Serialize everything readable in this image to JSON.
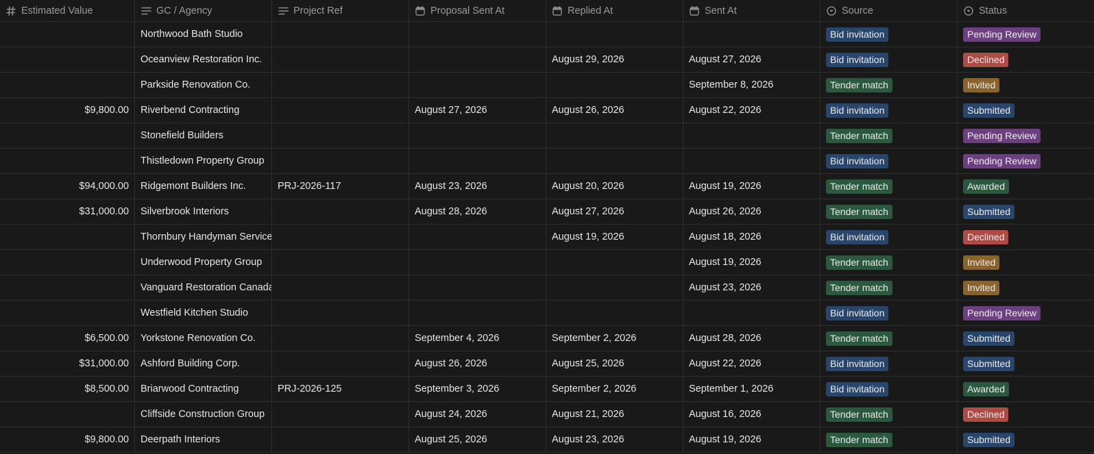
{
  "colors": {
    "background": "#191919",
    "border": "#2f2f2f",
    "text": "#e6e6e4",
    "header_text": "#9b9b9b",
    "tag_bid_invitation": "#28456c",
    "tag_tender_match": "#2b593f",
    "tag_pending_review": "#6c3f81",
    "tag_declined": "#b04a45",
    "tag_invited": "#89632a",
    "tag_submitted": "#28456c",
    "tag_awarded": "#2b593f"
  },
  "columns": [
    {
      "label": "Estimated Value",
      "icon": "number-icon"
    },
    {
      "label": "GC / Agency",
      "icon": "text-lines-icon"
    },
    {
      "label": "Project Ref",
      "icon": "text-lines-icon"
    },
    {
      "label": "Proposal Sent At",
      "icon": "calendar-icon"
    },
    {
      "label": "Replied At",
      "icon": "calendar-icon"
    },
    {
      "label": "Sent At",
      "icon": "calendar-icon"
    },
    {
      "label": "Source",
      "icon": "select-icon"
    },
    {
      "label": "Status",
      "icon": "select-icon"
    }
  ],
  "rows": [
    {
      "value": "",
      "agency": "Northwood Bath Studio",
      "ref": "",
      "proposal": "",
      "replied": "",
      "sent": "",
      "source": "Bid invitation",
      "status": "Pending Review"
    },
    {
      "value": "",
      "agency": "Oceanview Restoration Inc.",
      "ref": "",
      "proposal": "",
      "replied": "August 29, 2026",
      "sent": "August 27, 2026",
      "source": "Bid invitation",
      "status": "Declined"
    },
    {
      "value": "",
      "agency": "Parkside Renovation Co.",
      "ref": "",
      "proposal": "",
      "replied": "",
      "sent": "September 8, 2026",
      "source": "Tender match",
      "status": "Invited"
    },
    {
      "value": "$9,800.00",
      "agency": "Riverbend Contracting",
      "ref": "",
      "proposal": "August 27, 2026",
      "replied": "August 26, 2026",
      "sent": "August 22, 2026",
      "source": "Bid invitation",
      "status": "Submitted"
    },
    {
      "value": "",
      "agency": "Stonefield Builders",
      "ref": "",
      "proposal": "",
      "replied": "",
      "sent": "",
      "source": "Tender match",
      "status": "Pending Review"
    },
    {
      "value": "",
      "agency": "Thistledown Property Group",
      "ref": "",
      "proposal": "",
      "replied": "",
      "sent": "",
      "source": "Bid invitation",
      "status": "Pending Review"
    },
    {
      "value": "$94,000.00",
      "agency": "Ridgemont Builders Inc.",
      "ref": "PRJ-2026-117",
      "proposal": "August 23, 2026",
      "replied": "August 20, 2026",
      "sent": "August 19, 2026",
      "source": "Tender match",
      "status": "Awarded"
    },
    {
      "value": "$31,000.00",
      "agency": "Silverbrook Interiors",
      "ref": "",
      "proposal": "August 28, 2026",
      "replied": "August 27, 2026",
      "sent": "August 26, 2026",
      "source": "Tender match",
      "status": "Submitted"
    },
    {
      "value": "",
      "agency": "Thornbury Handyman Service",
      "ref": "",
      "proposal": "",
      "replied": "August 19, 2026",
      "sent": "August 18, 2026",
      "source": "Bid invitation",
      "status": "Declined"
    },
    {
      "value": "",
      "agency": "Underwood Property Group",
      "ref": "",
      "proposal": "",
      "replied": "",
      "sent": "August 19, 2026",
      "source": "Tender match",
      "status": "Invited"
    },
    {
      "value": "",
      "agency": "Vanguard Restoration Canada",
      "ref": "",
      "proposal": "",
      "replied": "",
      "sent": "August 23, 2026",
      "source": "Tender match",
      "status": "Invited"
    },
    {
      "value": "",
      "agency": "Westfield Kitchen Studio",
      "ref": "",
      "proposal": "",
      "replied": "",
      "sent": "",
      "source": "Bid invitation",
      "status": "Pending Review"
    },
    {
      "value": "$6,500.00",
      "agency": "Yorkstone Renovation Co.",
      "ref": "",
      "proposal": "September 4, 2026",
      "replied": "September 2, 2026",
      "sent": "August 28, 2026",
      "source": "Tender match",
      "status": "Submitted"
    },
    {
      "value": "$31,000.00",
      "agency": "Ashford Building Corp.",
      "ref": "",
      "proposal": "August 26, 2026",
      "replied": "August 25, 2026",
      "sent": "August 22, 2026",
      "source": "Bid invitation",
      "status": "Submitted"
    },
    {
      "value": "$8,500.00",
      "agency": "Briarwood Contracting",
      "ref": "PRJ-2026-125",
      "proposal": "September 3, 2026",
      "replied": "September 2, 2026",
      "sent": "September 1, 2026",
      "source": "Bid invitation",
      "status": "Awarded"
    },
    {
      "value": "",
      "agency": "Cliffside Construction Group",
      "ref": "",
      "proposal": "August 24, 2026",
      "replied": "August 21, 2026",
      "sent": "August 16, 2026",
      "source": "Tender match",
      "status": "Declined"
    },
    {
      "value": "$9,800.00",
      "agency": "Deerpath Interiors",
      "ref": "",
      "proposal": "August 25, 2026",
      "replied": "August 23, 2026",
      "sent": "August 19, 2026",
      "source": "Tender match",
      "status": "Submitted"
    }
  ]
}
